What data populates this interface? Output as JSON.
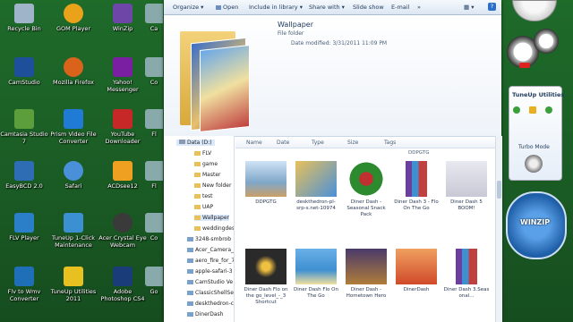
{
  "desktop": {
    "icons": [
      {
        "label": "Recycle Bin",
        "color": "#9fb4c8"
      },
      {
        "label": "GOM Player",
        "color": "#e9a21a"
      },
      {
        "label": "WinZip",
        "color": "#6d46a8"
      },
      {
        "label": "Ca"
      },
      {
        "label": "CamStudio",
        "color": "#1d4f9a"
      },
      {
        "label": "Mozilla Firefox",
        "color": "#d9631b"
      },
      {
        "label": "Yahoo! Messenger",
        "color": "#7b1fa2"
      },
      {
        "label": "Co"
      },
      {
        "label": "Camtasia Studio 7",
        "color": "#5b9e3b"
      },
      {
        "label": "Prism Video File Converter",
        "color": "#1f7bd6"
      },
      {
        "label": "YouTube Downloader",
        "color": "#c62828"
      },
      {
        "label": "Fl"
      },
      {
        "label": "EasyBCD 2.0",
        "color": "#2e6db3"
      },
      {
        "label": "Safari",
        "color": "#4a90d9"
      },
      {
        "label": "ACDsee12",
        "color": "#f0a020"
      },
      {
        "label": "Fl"
      },
      {
        "label": "FLV Player",
        "color": "#2b7fc9"
      },
      {
        "label": "TuneUp 1-Click Maintenance",
        "color": "#3c8fd0"
      },
      {
        "label": "Acer Crystal Eye Webcam",
        "color": "#3a3a3a"
      },
      {
        "label": "Co"
      },
      {
        "label": "Flv to Wmv Converter",
        "color": "#1f6fb8"
      },
      {
        "label": "TuneUp Utilities 2011",
        "color": "#e8c020"
      },
      {
        "label": "Adobe Photoshop CS4",
        "color": "#1a3d7a"
      },
      {
        "label": "Go"
      }
    ]
  },
  "toolbar": {
    "organize": "Organize ▾",
    "open": "Open",
    "include": "Include in library ▾",
    "share": "Share with ▾",
    "slideshow": "Slide show",
    "email": "E-mail",
    "more": "»"
  },
  "preview": {
    "name": "Wallpaper",
    "type": "File folder",
    "modified": "Date modified: 3/31/2011 11:09 PM"
  },
  "nav": {
    "drive": "Data (D:)",
    "items": [
      "FLV",
      "game",
      "Master",
      "New folder",
      "test",
      "UAP",
      "Wallpaper",
      "weddingdesh",
      "3248-smbrob",
      "Acer_Camera_",
      "aero_fire_for_7",
      "apple-safari-3",
      "CamStudio Ve",
      "ClassicShellSe",
      "deskthedron-c",
      "DinerDash"
    ]
  },
  "columns": {
    "name": "Name",
    "date": "Date",
    "type": "Type",
    "size": "Size",
    "tags": "Tags"
  },
  "files": {
    "search_hint": "DDPGTG",
    "items": [
      {
        "label": "DDPGTG",
        "color": "#7fa7c9"
      },
      {
        "label": "deskthedron-pl-srp-s.net-10974",
        "color": "#e8c15a"
      },
      {
        "label": "Diner Dash - Seasonal Snack Pack",
        "color": "#2e8a2e"
      },
      {
        "label": "Diner Dash 3 - Flo On The Go",
        "color": "#6b3fa0"
      },
      {
        "label": "Diner Dash 5 BOOM!",
        "color": "#c9c9d6"
      },
      {
        "label": "Diner Dash Flo on the go_level_-_3 Shortcut",
        "color": "#2a2a2a"
      },
      {
        "label": "Diner Dash Flo On The Go",
        "color": "#3f8fd1"
      },
      {
        "label": "Diner Dash - Hometown Hero",
        "color": "#b07d3a"
      },
      {
        "label": "DinerDash",
        "color": "#d04a2a"
      },
      {
        "label": "Diner Dash 3.Seas onal...",
        "color": "#6b3fa0"
      }
    ]
  },
  "gadgets": {
    "tuneup_title": "TuneUp Utilities",
    "turbo_mode": "Turbo Mode",
    "zip_text": "WINZIP"
  }
}
